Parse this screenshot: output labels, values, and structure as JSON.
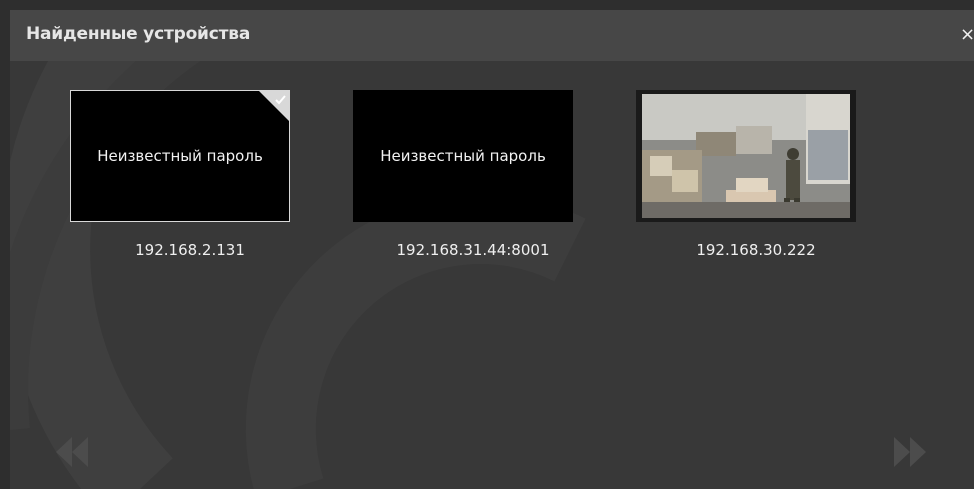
{
  "dialog": {
    "title": "Найденные устройства",
    "close_label": "×"
  },
  "devices": [
    {
      "status": "Неизвестный пароль",
      "ip": "192.168.2.131",
      "selected": true
    },
    {
      "status": "Неизвестный пароль",
      "ip": "192.168.31.44:8001",
      "selected": false
    },
    {
      "status": "",
      "ip": "192.168.30.222",
      "selected": false,
      "preview": "camera-preview-warehouse"
    }
  ],
  "nav": {
    "prev_icon": "double-chevron-left-icon",
    "next_icon": "double-chevron-right-icon"
  },
  "colors": {
    "background": "#383838",
    "titlebar": "#474747",
    "text": "#efefef"
  }
}
